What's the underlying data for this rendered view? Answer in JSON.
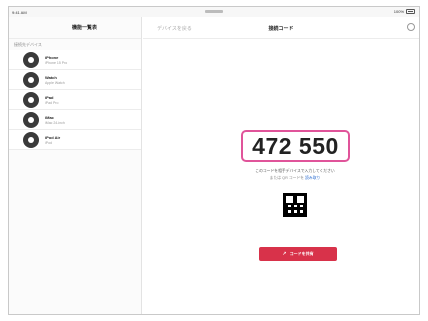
{
  "status_bar": {
    "left": "9:41 AM",
    "right": "100%"
  },
  "sidebar": {
    "title": "機能一覧表",
    "section_label": "接続先デバイス",
    "devices": [
      {
        "name": "iPhone",
        "subtitle": "iPhone 15 Pro"
      },
      {
        "name": "Watch",
        "subtitle": "Apple Watch"
      },
      {
        "name": "iPad",
        "subtitle": "iPad Pro"
      },
      {
        "name": "iMac",
        "subtitle": "iMac 24-inch"
      },
      {
        "name": "iPod Air",
        "subtitle": "iPod"
      }
    ]
  },
  "main": {
    "back_label": "デバイスを戻る",
    "title": "接続コード",
    "code": "472 550",
    "description_line1": "このコードを相手デバイスで入力してください",
    "description_line2_prefix": "または QR コードを",
    "description_line2_link": "読み取り",
    "share_button_label": "コードを共有"
  }
}
